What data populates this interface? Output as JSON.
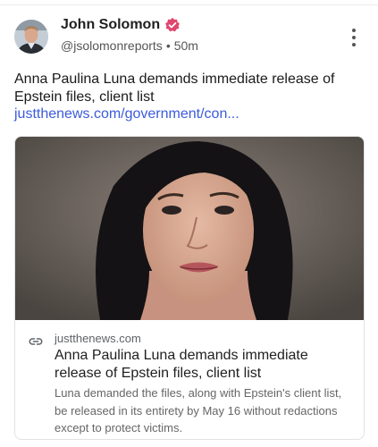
{
  "post": {
    "author": {
      "name": "John Solomon",
      "handle": "@jsolomonreports",
      "time": "50m"
    },
    "text": "Anna Paulina Luna demands immediate release of Epstein files, client list ",
    "link_text": "justthenews.com/government/con...",
    "card": {
      "domain": "justthenews.com",
      "title": "Anna Paulina Luna demands immediate release of Epstein files, client list",
      "description": "Luna demanded the files, along with Epstein's client list, be released in its entirety by May 16 without redactions except to protect victims."
    }
  },
  "icons": {
    "verified": "verified-badge-icon",
    "more": "more-vertical-icon",
    "link": "link-icon"
  },
  "colors": {
    "verified_badge": "#e0466e",
    "link": "#3b5bdb"
  }
}
